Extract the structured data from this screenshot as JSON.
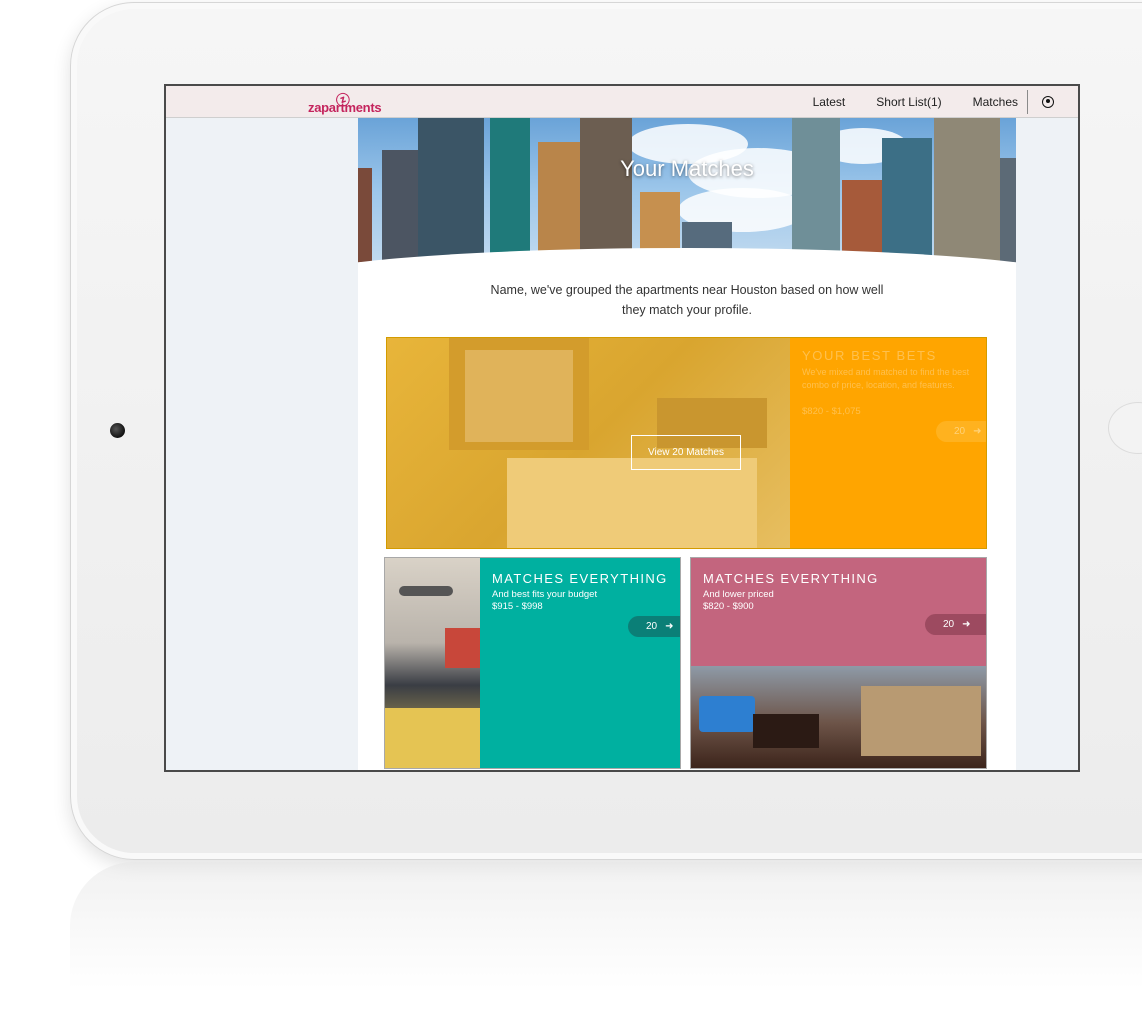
{
  "brand": {
    "name": "zapartments"
  },
  "nav": {
    "latest": "Latest",
    "shortlist": "Short List(1)",
    "matches": "Matches"
  },
  "hero": {
    "title": "Your Matches"
  },
  "intro": "Name, we've grouped the apartments near Houston based on how well they match your profile.",
  "cards": {
    "best": {
      "title": "YOUR BEST BETS",
      "description": "We've mixed and matched to find the best combo of price, location, and features.",
      "price": "$820 - $1,075",
      "count": "20",
      "view_button": "View 20 Matches"
    },
    "budget": {
      "title": "MATCHES EVERYTHING",
      "subtitle": "And best fits your budget",
      "price": "$915 - $998",
      "count": "20"
    },
    "lower": {
      "title": "MATCHES EVERYTHING",
      "subtitle": "And lower priced",
      "price": "$820 - $900",
      "count": "20"
    }
  },
  "icons": {
    "arrow": "arrow-right-icon",
    "user": "user-icon",
    "camera": "camera-icon"
  },
  "colors": {
    "brand": "#c4245d",
    "best_bets": "#ffa500",
    "budget": "#00b0a0",
    "lower_price": "#c3657e"
  }
}
